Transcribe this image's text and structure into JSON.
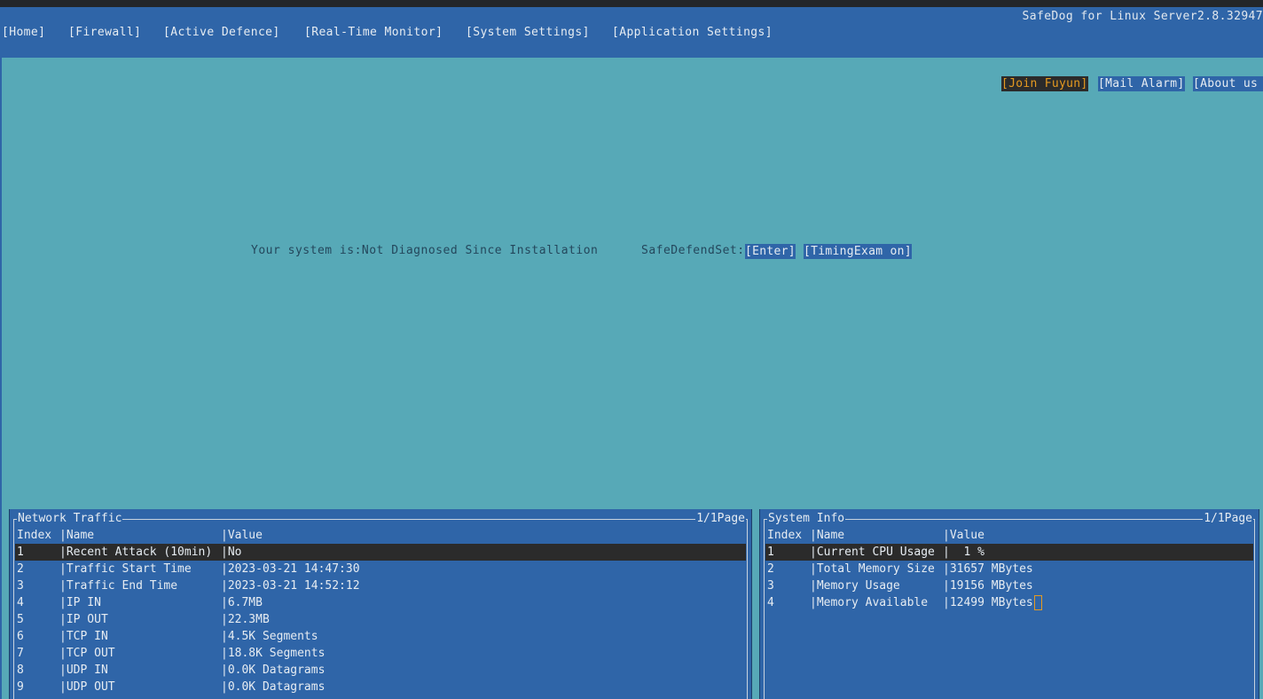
{
  "app": {
    "title": "SafeDog for Linux Server2.8.32947"
  },
  "menu": {
    "items": [
      {
        "label": "[Home]"
      },
      {
        "label": "[Firewall]"
      },
      {
        "label": "[Active Defence]"
      },
      {
        "label": "[Real-Time Monitor]"
      },
      {
        "label": "[System Settings]"
      },
      {
        "label": "[Application Settings]"
      }
    ]
  },
  "top_buttons": {
    "join": "[Join Fuyun]",
    "mail": "[Mail Alarm]",
    "about": "[About us"
  },
  "status": {
    "system_status": "Your system is:Not Diagnosed Since Installation",
    "defend_label": "SafeDefendSet:",
    "enter_button": "[Enter]",
    "timing_button": "[TimingExam  on]"
  },
  "network_panel": {
    "title": "Network Traffic",
    "page": "1/1Page",
    "headers": {
      "index": "Index",
      "name": "|Name",
      "value": "|Value"
    },
    "rows": [
      {
        "index": "1",
        "name": "|Recent Attack (10min)",
        "value": "|No"
      },
      {
        "index": "2",
        "name": "|Traffic Start Time",
        "value": "|2023-03-21 14:47:30"
      },
      {
        "index": "3",
        "name": "|Traffic End Time",
        "value": "|2023-03-21 14:52:12"
      },
      {
        "index": "4",
        "name": "|IP IN",
        "value": "|6.7MB"
      },
      {
        "index": "5",
        "name": "|IP OUT",
        "value": "|22.3MB"
      },
      {
        "index": "6",
        "name": "|TCP IN",
        "value": "|4.5K Segments"
      },
      {
        "index": "7",
        "name": "|TCP OUT",
        "value": "|18.8K Segments"
      },
      {
        "index": "8",
        "name": "|UDP IN",
        "value": "|0.0K Datagrams"
      },
      {
        "index": "9",
        "name": "|UDP OUT",
        "value": "|0.0K Datagrams"
      }
    ]
  },
  "system_panel": {
    "title": "System Info",
    "page": "1/1Page",
    "headers": {
      "index": "Index",
      "name": "|Name",
      "value": "|Value"
    },
    "rows": [
      {
        "index": "1",
        "name": "|Current CPU Usage",
        "value": "|  1 %"
      },
      {
        "index": "2",
        "name": "|Total Memory Size",
        "value": "|31657 MBytes"
      },
      {
        "index": "3",
        "name": "|Memory Usage",
        "value": "|19156 MBytes"
      },
      {
        "index": "4",
        "name": "|Memory Available",
        "value": "|12499 MBytes"
      }
    ]
  }
}
